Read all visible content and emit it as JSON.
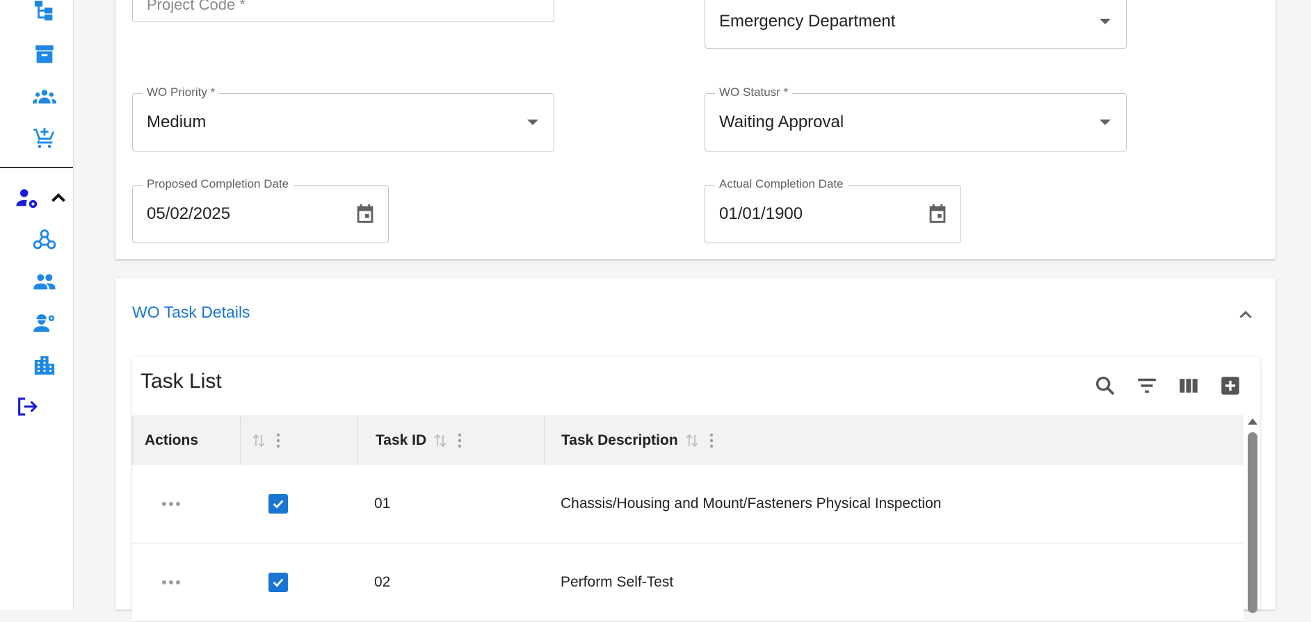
{
  "form": {
    "project_code_label": "Project Code *",
    "department_value": "Emergency Department",
    "wo_priority_label": "WO Priority *",
    "wo_priority_value": "Medium",
    "wo_status_label": "WO Statusr *",
    "wo_status_value": "Waiting Approval",
    "proposed_completion_label": "Proposed Completion Date",
    "proposed_completion_value": "05/02/2025",
    "actual_completion_label": "Actual Completion Date",
    "actual_completion_value": "01/01/1900"
  },
  "task_section": {
    "title": "WO Task Details",
    "table_title": "Task List",
    "columns": [
      "Actions",
      "",
      "Task ID",
      "Task Description"
    ],
    "rows": [
      {
        "checked": true,
        "task_id": "01",
        "description": "Chassis/Housing and Mount/Fasteners Physical Inspection"
      },
      {
        "checked": true,
        "task_id": "02",
        "description": "Perform Self-Test"
      }
    ]
  },
  "icons": {
    "sidebar": [
      "hierarchy-icon",
      "archive-icon",
      "groups-icon",
      "cart-add-icon",
      "user-settings-icon",
      "webhook-icon",
      "people-icon",
      "engineer-icon",
      "buildings-icon",
      "logout-icon"
    ],
    "toolbar": [
      "search-icon",
      "filter-icon",
      "columns-icon",
      "add-box-icon"
    ]
  },
  "colors": {
    "accent": "#1976d2",
    "sidebar_icon": "#1e88e5",
    "sidebar_active": "#1a1adb"
  }
}
